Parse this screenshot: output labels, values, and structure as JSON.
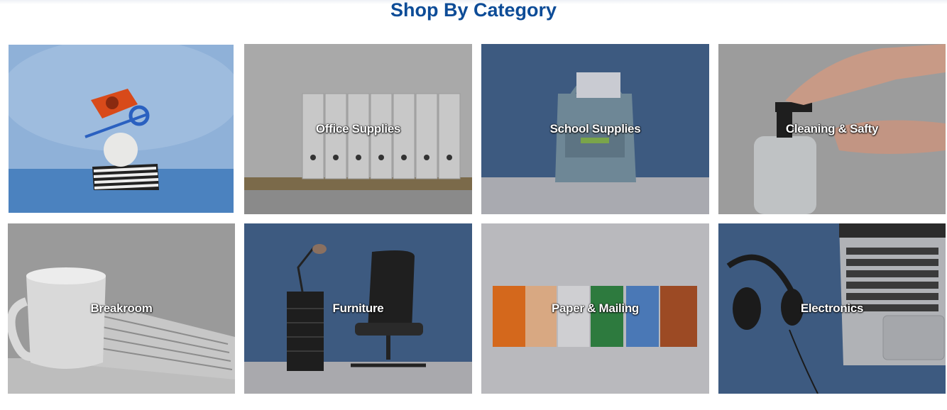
{
  "section": {
    "title": "Shop By Category"
  },
  "categories": [
    {
      "label": ""
    },
    {
      "label": "Office Supplies"
    },
    {
      "label": "School Supplies"
    },
    {
      "label": "Cleaning & Safty"
    },
    {
      "label": "Breakroom"
    },
    {
      "label": "Furniture"
    },
    {
      "label": "Paper & Mailing"
    },
    {
      "label": "Electronics"
    }
  ],
  "colors": {
    "title": "#0d4c97",
    "label": "#ffffff"
  }
}
